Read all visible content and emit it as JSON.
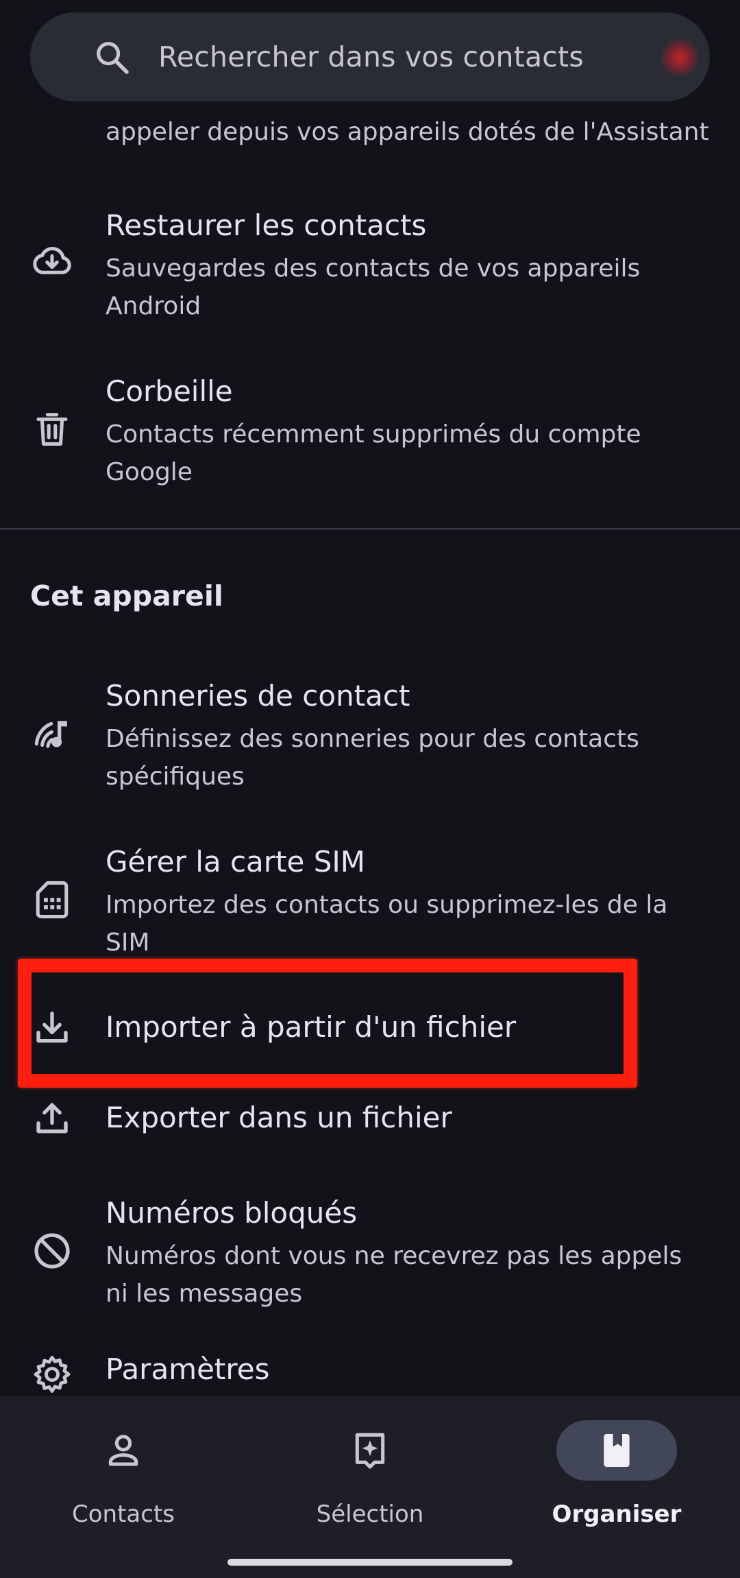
{
  "search": {
    "placeholder": "Rechercher dans vos contacts"
  },
  "partial_item": {
    "text": "appeler depuis vos appareils dotés de l'Assistant"
  },
  "google_items": [
    {
      "icon": "cloud-download-icon",
      "title": "Restaurer les contacts",
      "subtitle": "Sauvegardes des contacts de vos appareils Android"
    },
    {
      "icon": "trash-icon",
      "title": "Corbeille",
      "subtitle": "Contacts récemment supprimés du compte Google"
    }
  ],
  "device_section": {
    "title": "Cet appareil",
    "items": [
      {
        "icon": "ringtone-icon",
        "title": "Sonneries de contact",
        "subtitle": "Définissez des sonneries pour des contacts spécifiques"
      },
      {
        "icon": "sim-card-icon",
        "title": "Gérer la carte SIM",
        "subtitle": "Importez des contacts ou supprimez-les de la SIM"
      },
      {
        "icon": "download-icon",
        "title": "Importer à partir d'un fichier"
      },
      {
        "icon": "upload-icon",
        "title": "Exporter dans un fichier"
      },
      {
        "icon": "block-icon",
        "title": "Numéros bloqués",
        "subtitle": "Numéros dont vous ne recevrez pas les appels ni les messages"
      },
      {
        "icon": "gear-icon",
        "title": "Paramètres"
      }
    ]
  },
  "bottom_nav": {
    "items": [
      {
        "icon": "person-icon",
        "label": "Contacts",
        "active": false
      },
      {
        "icon": "sparkle-bookmark-icon",
        "label": "Sélection",
        "active": false
      },
      {
        "icon": "book-icon",
        "label": "Organiser",
        "active": true
      }
    ]
  },
  "colors": {
    "background": "#121318",
    "search_bar": "#2a2c35",
    "highlight": "#ff1f0f",
    "active_pill": "#424659"
  }
}
